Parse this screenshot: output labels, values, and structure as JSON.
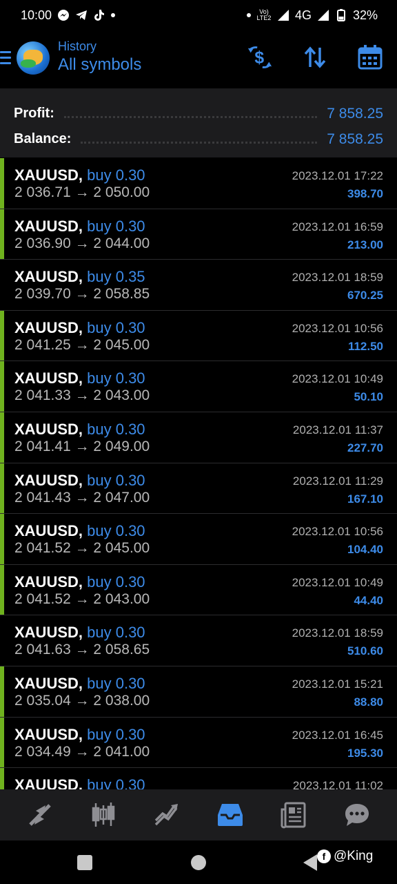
{
  "status_bar": {
    "time": "10:00",
    "network": "4G",
    "battery": "32%",
    "volte": "VoLTE2"
  },
  "header": {
    "subtitle": "History",
    "title": "All symbols"
  },
  "summary": {
    "profit_label": "Profit:",
    "profit_value": "7 858.25",
    "balance_label": "Balance:",
    "balance_value": "7 858.25"
  },
  "trades": [
    {
      "symbol": "XAUUSD,",
      "side": "buy 0.30",
      "prices": "2 036.71 → 2 050.00",
      "time": "2023.12.01 17:22",
      "profit": "398.70",
      "marked": true
    },
    {
      "symbol": "XAUUSD,",
      "side": "buy 0.30",
      "prices": "2 036.90 → 2 044.00",
      "time": "2023.12.01 16:59",
      "profit": "213.00",
      "marked": true
    },
    {
      "symbol": "XAUUSD,",
      "side": "buy 0.35",
      "prices": "2 039.70 → 2 058.85",
      "time": "2023.12.01 18:59",
      "profit": "670.25",
      "marked": false
    },
    {
      "symbol": "XAUUSD,",
      "side": "buy 0.30",
      "prices": "2 041.25 → 2 045.00",
      "time": "2023.12.01 10:56",
      "profit": "112.50",
      "marked": true
    },
    {
      "symbol": "XAUUSD,",
      "side": "buy 0.30",
      "prices": "2 041.33 → 2 043.00",
      "time": "2023.12.01 10:49",
      "profit": "50.10",
      "marked": true
    },
    {
      "symbol": "XAUUSD,",
      "side": "buy 0.30",
      "prices": "2 041.41 → 2 049.00",
      "time": "2023.12.01 11:37",
      "profit": "227.70",
      "marked": true
    },
    {
      "symbol": "XAUUSD,",
      "side": "buy 0.30",
      "prices": "2 041.43 → 2 047.00",
      "time": "2023.12.01 11:29",
      "profit": "167.10",
      "marked": true
    },
    {
      "symbol": "XAUUSD,",
      "side": "buy 0.30",
      "prices": "2 041.52 → 2 045.00",
      "time": "2023.12.01 10:56",
      "profit": "104.40",
      "marked": true
    },
    {
      "symbol": "XAUUSD,",
      "side": "buy 0.30",
      "prices": "2 041.52 → 2 043.00",
      "time": "2023.12.01 10:49",
      "profit": "44.40",
      "marked": true
    },
    {
      "symbol": "XAUUSD,",
      "side": "buy 0.30",
      "prices": "2 041.63 → 2 058.65",
      "time": "2023.12.01 18:59",
      "profit": "510.60",
      "marked": false
    },
    {
      "symbol": "XAUUSD,",
      "side": "buy 0.30",
      "prices": "2 035.04 → 2 038.00",
      "time": "2023.12.01 15:21",
      "profit": "88.80",
      "marked": true
    },
    {
      "symbol": "XAUUSD,",
      "side": "buy 0.30",
      "prices": "2 034.49 → 2 041.00",
      "time": "2023.12.01 16:45",
      "profit": "195.30",
      "marked": true
    },
    {
      "symbol": "XAUUSD,",
      "side": "buy 0.30",
      "prices": "",
      "time": "2023.12.01 11:02",
      "profit": "",
      "marked": true
    }
  ],
  "bottom_nav": [
    {
      "name": "quotes",
      "icon": "quotes-arrows-icon"
    },
    {
      "name": "chart",
      "icon": "candlestick-icon"
    },
    {
      "name": "trade",
      "icon": "trend-icon"
    },
    {
      "name": "history",
      "icon": "inbox-icon",
      "active": true
    },
    {
      "name": "news",
      "icon": "newspaper-icon"
    },
    {
      "name": "messages",
      "icon": "chat-icon"
    }
  ],
  "watermark": {
    "text": "@King"
  },
  "colors": {
    "accent": "#3d8be8",
    "marker": "#6fb21e",
    "background": "#000000",
    "panel": "#1c1c1e"
  }
}
